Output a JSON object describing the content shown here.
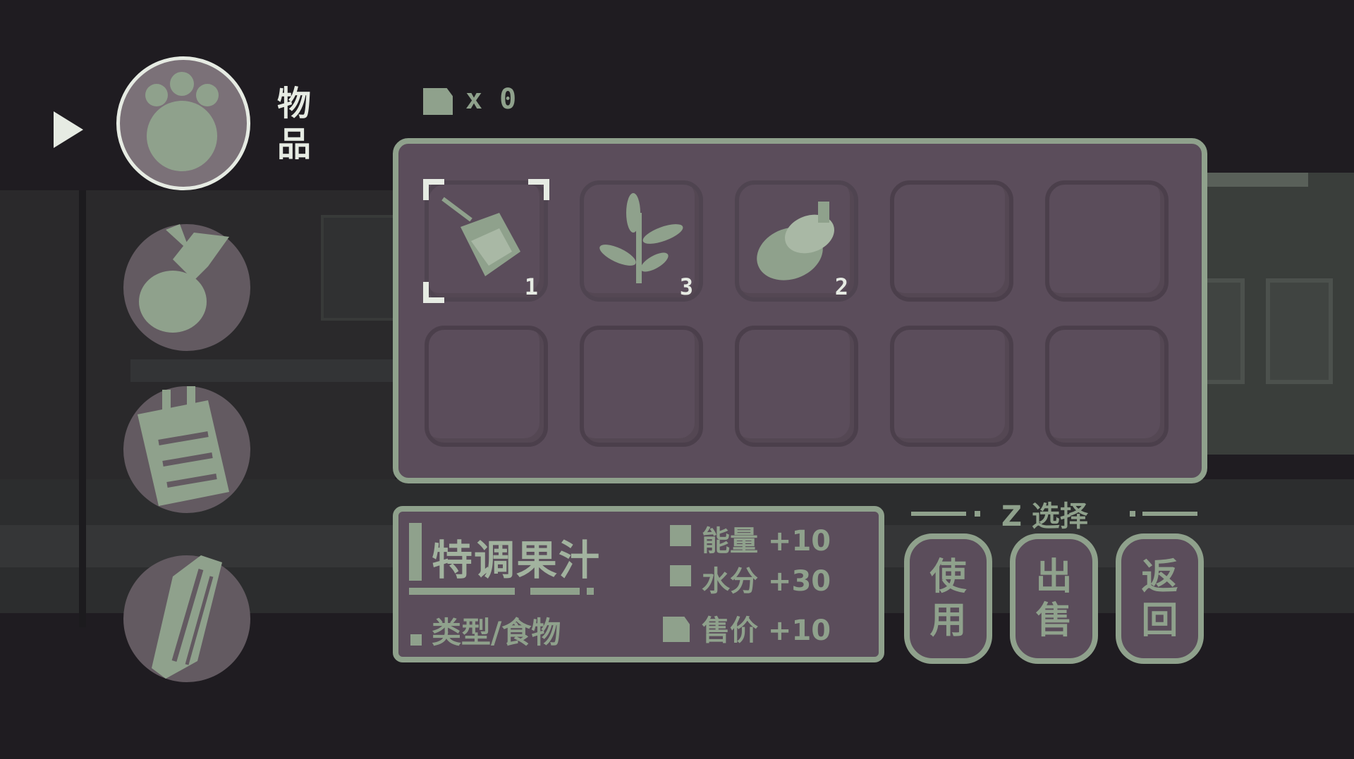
{
  "category_menu": {
    "selected_label": "物品",
    "items": [
      {
        "icon": "paw-icon",
        "selected": true
      },
      {
        "icon": "fish-icon",
        "selected": false
      },
      {
        "icon": "clipboard-icon",
        "selected": false
      },
      {
        "icon": "pencil-icon",
        "selected": false
      }
    ]
  },
  "currency": {
    "icon": "coin-icon",
    "text": "x 0"
  },
  "inventory": {
    "slots": [
      {
        "icon": "juice-cup-icon",
        "qty": "1",
        "selected": true
      },
      {
        "icon": "herb-icon",
        "qty": "3",
        "selected": false
      },
      {
        "icon": "acorn-icon",
        "qty": "2",
        "selected": false
      },
      {
        "icon": "",
        "qty": "",
        "selected": false
      },
      {
        "icon": "",
        "qty": "",
        "selected": false
      },
      {
        "icon": "",
        "qty": "",
        "selected": false
      },
      {
        "icon": "",
        "qty": "",
        "selected": false
      },
      {
        "icon": "",
        "qty": "",
        "selected": false
      },
      {
        "icon": "",
        "qty": "",
        "selected": false
      },
      {
        "icon": "",
        "qty": "",
        "selected": false
      }
    ]
  },
  "item_info": {
    "name": "特调果汁",
    "type": "类型/食物",
    "stats": [
      "能量 +10",
      "水分 +30",
      "售价 +10"
    ]
  },
  "actions": {
    "hint": "Z 选择",
    "buttons": [
      "使用",
      "出售",
      "返回"
    ]
  },
  "colors": {
    "background": "#1f1c21",
    "panel": "#5b4d5b",
    "accent": "#8fa18c",
    "highlight": "#e6ebe3"
  }
}
